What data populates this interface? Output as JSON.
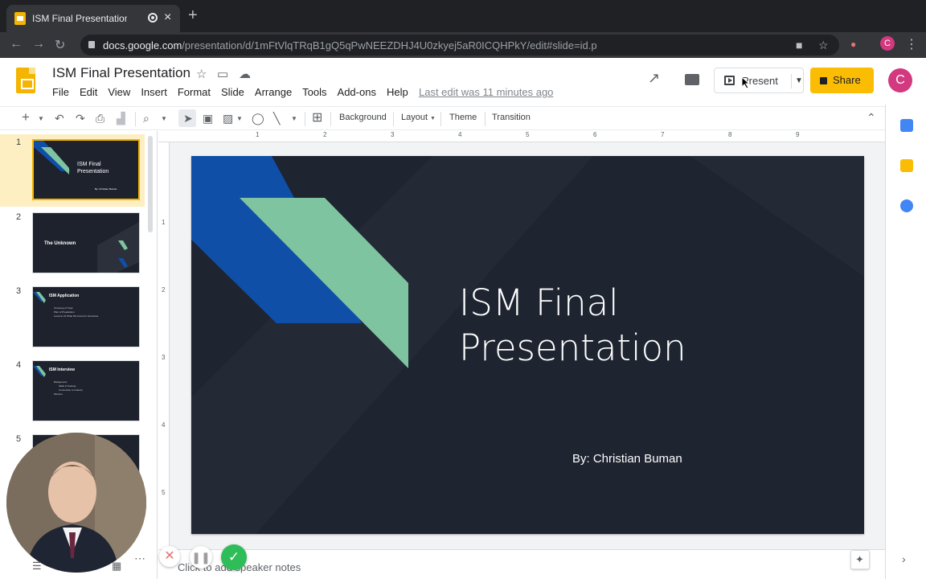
{
  "browser": {
    "tab_title": "ISM Final Presentation - Google Slides",
    "url_host": "docs.google.com",
    "url_path": "/presentation/d/1mFtVlqTRqB1gQ5qPwNEEZDHJ4U0zkyej5aR0ICQHPkY/edit#slide=id.p",
    "profile_initial": "C"
  },
  "header": {
    "doc_title": "ISM Final Presentation",
    "menus": [
      "File",
      "Edit",
      "View",
      "Insert",
      "Format",
      "Slide",
      "Arrange",
      "Tools",
      "Add-ons",
      "Help"
    ],
    "last_edit": "Last edit was 11 minutes ago",
    "present_label": "Present",
    "share_label": "Share",
    "avatar_initial": "C"
  },
  "toolbar": {
    "background_label": "Background",
    "layout_label": "Layout",
    "theme_label": "Theme",
    "transition_label": "Transition"
  },
  "filmstrip": {
    "slides": [
      {
        "number": "1",
        "title": "ISM Final Presentation",
        "subtitle": "By: Christian Buman"
      },
      {
        "number": "2",
        "title": "The Unknown"
      },
      {
        "number": "3",
        "title": "ISM Application",
        "bullets": [
          "Choosing of Topic",
          "Plan of Preparation",
          "Lessons Of What We Found In Interviews"
        ]
      },
      {
        "number": "4",
        "title": "ISM Interview",
        "bullets": [
          "Background",
          "Skills & Training",
          "Connection to Industry",
          "Mentors"
        ]
      },
      {
        "number": "5"
      }
    ]
  },
  "ruler": {
    "top": [
      "1",
      "2",
      "3",
      "4",
      "5",
      "6",
      "7",
      "8",
      "9"
    ],
    "left": [
      "1",
      "2",
      "3",
      "4",
      "5"
    ]
  },
  "slide": {
    "title": "ISM Final\nPresentation",
    "subtitle": "By: Christian Buman",
    "colors": {
      "background": "#1e2430",
      "blue": "#0f4fa8",
      "green": "#7fc4a0"
    }
  },
  "notes": {
    "placeholder": "Click to add speaker notes"
  }
}
